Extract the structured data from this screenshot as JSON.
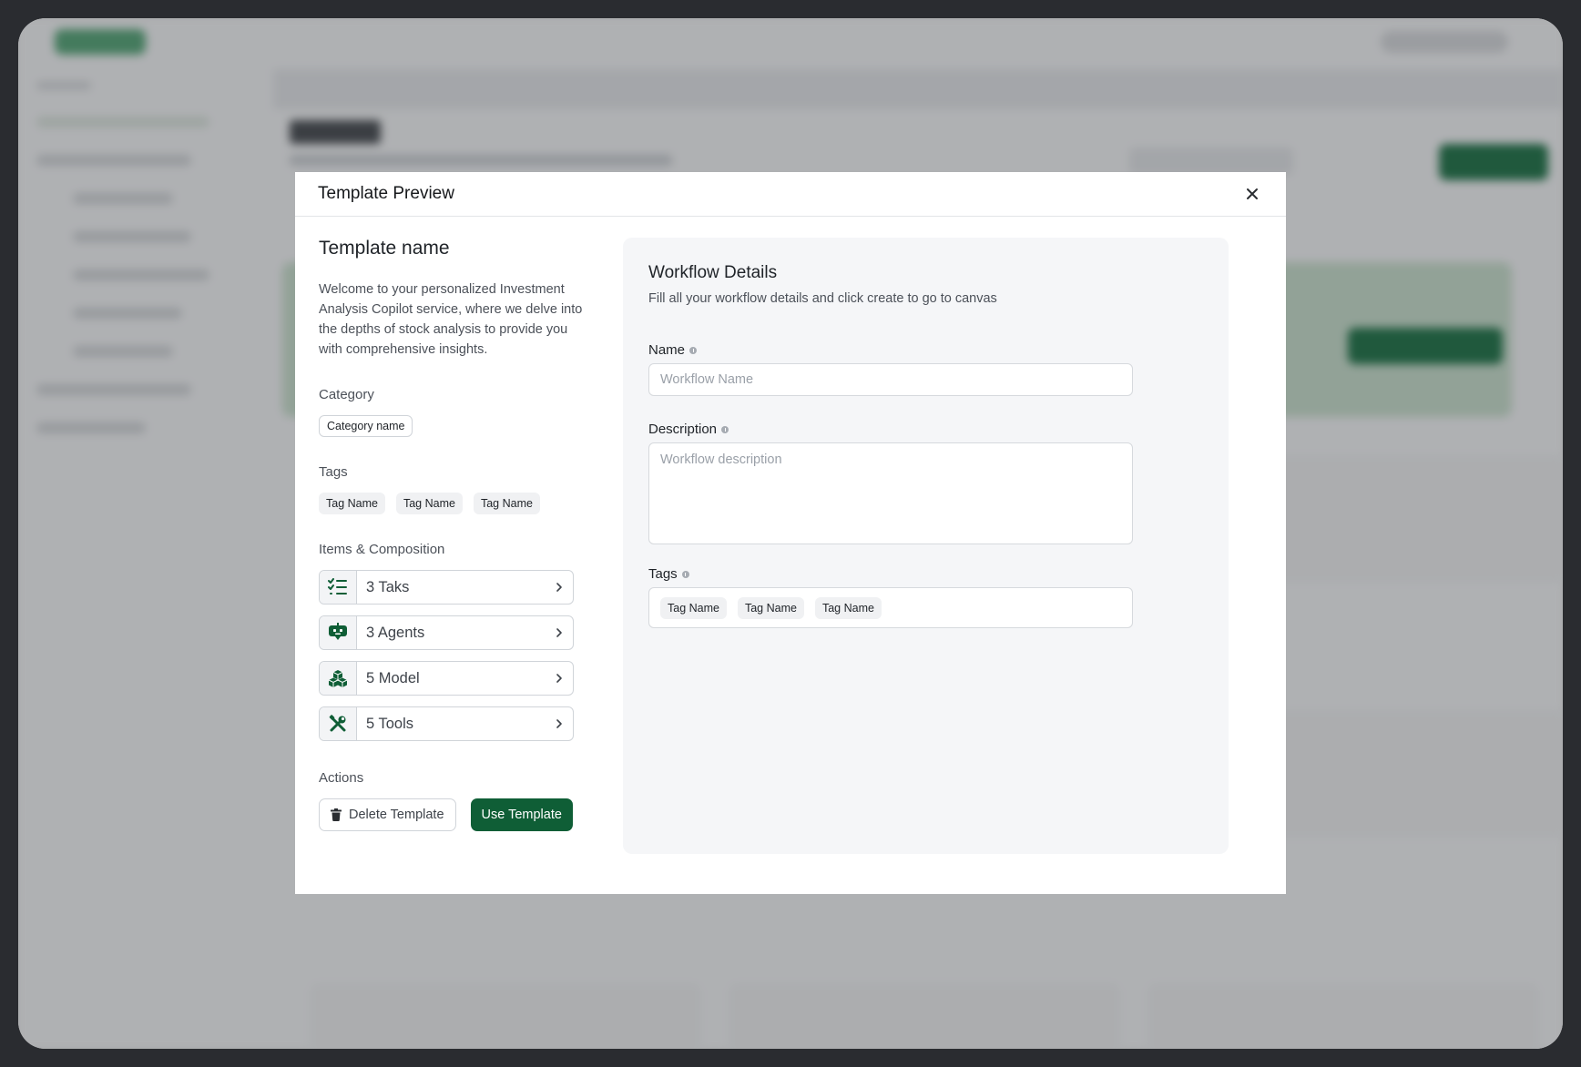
{
  "modal": {
    "title": "Template Preview"
  },
  "template": {
    "name": "Template name",
    "description": "Welcome to your personalized Investment Analysis Copilot service, where we delve into the depths of stock analysis to provide you with comprehensive insights.",
    "category_label": "Category",
    "category": "Category name",
    "tags_label": "Tags",
    "tags": [
      "Tag Name",
      "Tag Name",
      "Tag Name"
    ],
    "items_label": "Items & Composition",
    "items": [
      {
        "label": "3 Taks",
        "icon": "task-list-icon"
      },
      {
        "label": "3 Agents",
        "icon": "agent-bot-icon"
      },
      {
        "label": "5 Model",
        "icon": "cubes-icon"
      },
      {
        "label": "5 Tools",
        "icon": "tools-icon"
      }
    ],
    "actions_label": "Actions",
    "delete_label": "Delete Template",
    "use_label": "Use Template"
  },
  "workflow": {
    "title": "Workflow Details",
    "subtitle": "Fill all your workflow details and click create to go to canvas",
    "name_label": "Name",
    "name_placeholder": "Workflow Name",
    "description_label": "Description",
    "description_placeholder": "Workflow description",
    "tags_label": "Tags",
    "tags": [
      "Tag Name",
      "Tag Name",
      "Tag Name"
    ]
  },
  "colors": {
    "primary": "#0f5e36",
    "icon_green": "#0f5e36"
  }
}
